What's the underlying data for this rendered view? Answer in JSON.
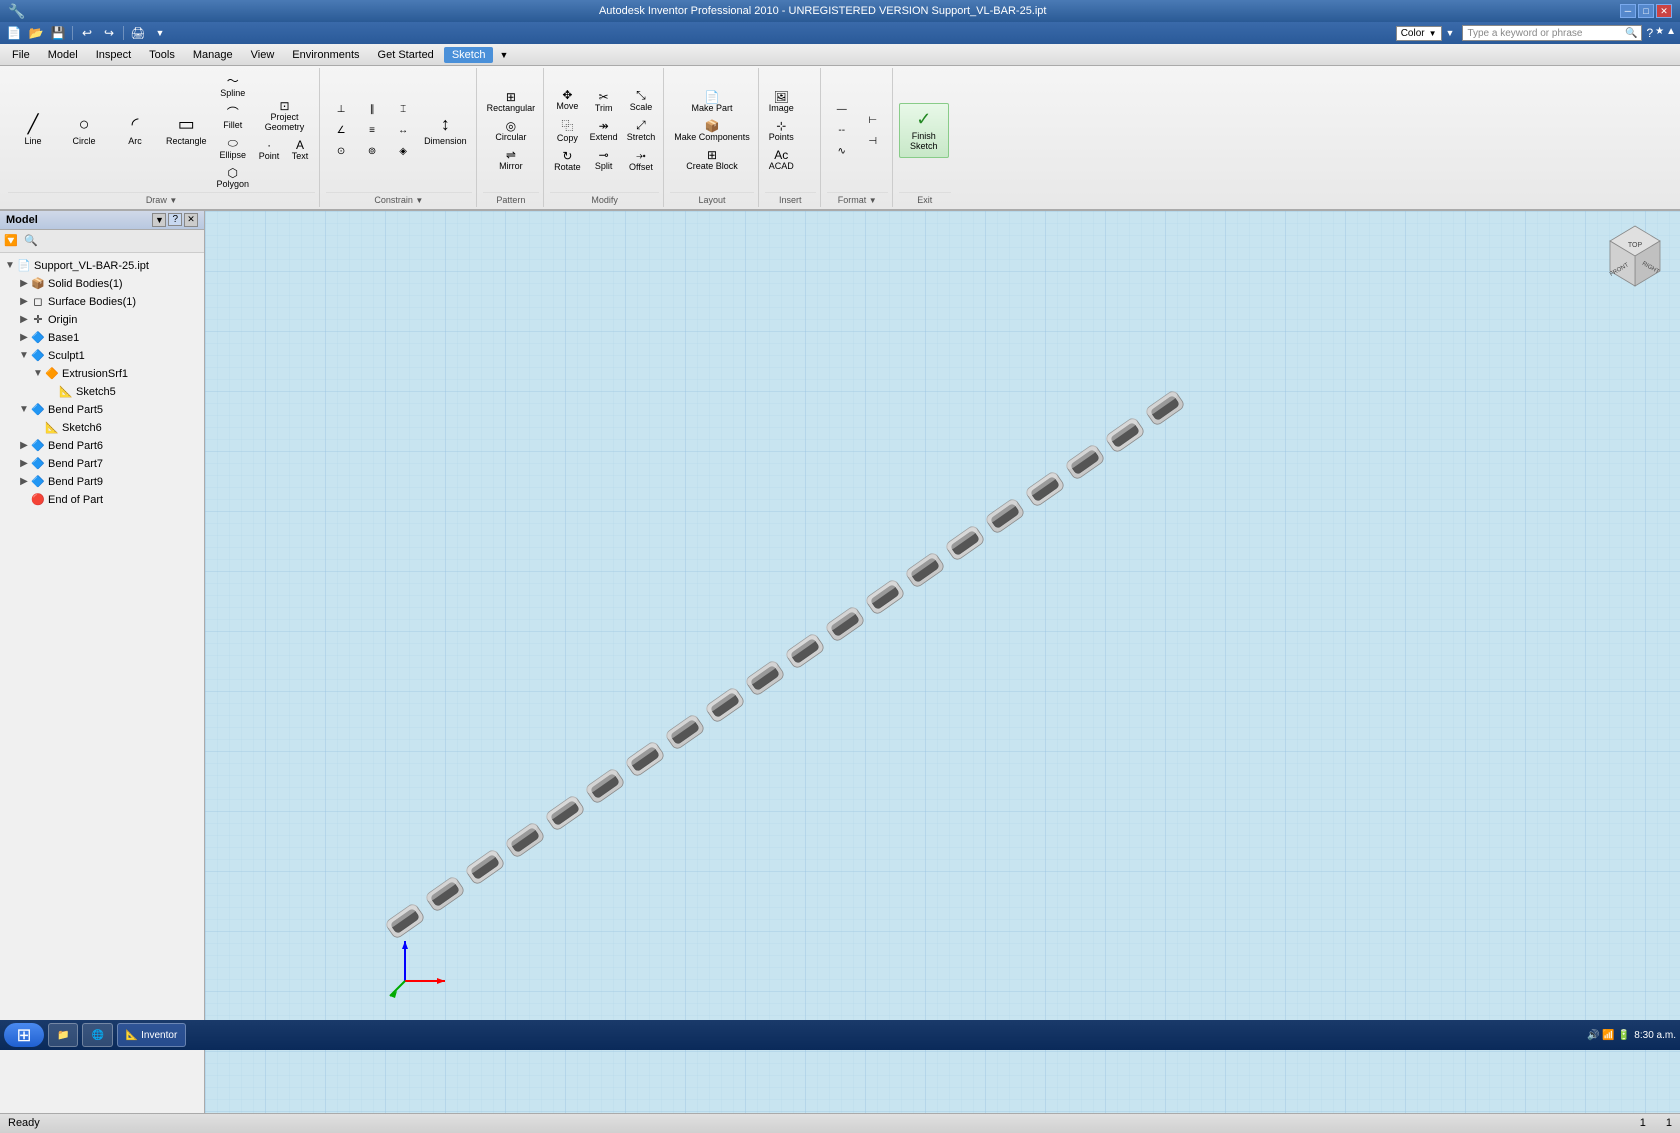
{
  "titlebar": {
    "title": "Autodesk Inventor Professional 2010 - UNREGISTERED VERSION    Support_VL-BAR-25.ipt",
    "minimize": "─",
    "maximize": "□",
    "close": "✕"
  },
  "quickaccess": {
    "buttons": [
      "↩",
      "↺",
      "↻",
      "💾",
      "📂",
      "🖨",
      "↩",
      "↩"
    ]
  },
  "menubar": {
    "items": [
      "File",
      "Model",
      "Inspect",
      "Tools",
      "Manage",
      "View",
      "Environments",
      "Get Started",
      "Sketch",
      "▼"
    ]
  },
  "ribbon": {
    "active_tab": "Sketch",
    "tabs": [
      "File",
      "Model",
      "Inspect",
      "Tools",
      "Manage",
      "View",
      "Environments",
      "Get Started",
      "Sketch"
    ],
    "groups": {
      "draw": {
        "label": "Draw",
        "tools": [
          "Line",
          "Circle",
          "Arc",
          "Rectangle",
          "Spline",
          "Fillet",
          "Ellipse",
          "Polygon",
          "Point",
          "Text",
          "Project Geometry"
        ]
      },
      "constrain": {
        "label": "Constrain"
      },
      "pattern": {
        "label": "Pattern",
        "tools": [
          "Rectangular",
          "Circular",
          "Mirror"
        ]
      },
      "modify": {
        "label": "Modify",
        "tools": [
          "Move",
          "Trim",
          "Scale",
          "Copy",
          "Extend",
          "Stretch",
          "Rotate",
          "Split",
          "Offset"
        ]
      },
      "layout": {
        "label": "Layout",
        "tools": [
          "Make Part",
          "Make Components",
          "Create Block"
        ]
      },
      "insert": {
        "label": "Insert",
        "tools": [
          "Image",
          "Points",
          "ACAD"
        ]
      },
      "format": {
        "label": "Format"
      },
      "exit": {
        "label": "Exit",
        "tools": [
          "Finish Sketch"
        ]
      }
    }
  },
  "panel": {
    "title": "Model",
    "dropdown": "▼",
    "close": "✕",
    "help": "?",
    "tree": [
      {
        "id": "root",
        "label": "Support_VL-BAR-25.ipt",
        "indent": 0,
        "expanded": true,
        "icon": "📄",
        "expand_icon": "▼"
      },
      {
        "id": "solid",
        "label": "Solid Bodies(1)",
        "indent": 1,
        "expanded": false,
        "icon": "📦",
        "expand_icon": "▶"
      },
      {
        "id": "surface",
        "label": "Surface Bodies(1)",
        "indent": 1,
        "expanded": false,
        "icon": "◻",
        "expand_icon": "▶"
      },
      {
        "id": "origin",
        "label": "Origin",
        "indent": 1,
        "expanded": false,
        "icon": "✛",
        "expand_icon": "▶"
      },
      {
        "id": "base1",
        "label": "Base1",
        "indent": 1,
        "expanded": false,
        "icon": "🔷",
        "expand_icon": "▶"
      },
      {
        "id": "sculpt1",
        "label": "Sculpt1",
        "indent": 1,
        "expanded": true,
        "icon": "🔷",
        "expand_icon": "▼"
      },
      {
        "id": "extrusion",
        "label": "ExtrusionSrf1",
        "indent": 2,
        "expanded": true,
        "icon": "🔶",
        "expand_icon": "▼"
      },
      {
        "id": "sketch5",
        "label": "Sketch5",
        "indent": 3,
        "expanded": false,
        "icon": "📐",
        "expand_icon": ""
      },
      {
        "id": "bendpart5",
        "label": "Bend Part5",
        "indent": 1,
        "expanded": true,
        "icon": "🔷",
        "expand_icon": "▼"
      },
      {
        "id": "sketch6",
        "label": "Sketch6",
        "indent": 2,
        "expanded": false,
        "icon": "📐",
        "expand_icon": ""
      },
      {
        "id": "bendpart6",
        "label": "Bend Part6",
        "indent": 1,
        "expanded": false,
        "icon": "🔷",
        "expand_icon": "▶"
      },
      {
        "id": "bendpart7",
        "label": "Bend Part7",
        "indent": 1,
        "expanded": false,
        "icon": "🔷",
        "expand_icon": "▶"
      },
      {
        "id": "bendpart9",
        "label": "Bend Part9",
        "indent": 1,
        "expanded": false,
        "icon": "🔷",
        "expand_icon": "▶"
      },
      {
        "id": "endofpart",
        "label": "End of Part",
        "indent": 1,
        "expanded": false,
        "icon": "🔴",
        "expand_icon": ""
      }
    ]
  },
  "viewport": {
    "background_color": "#c8e4f0",
    "grid_color": "#a8d4e8"
  },
  "viewcube": {
    "labels": [
      "FRONT",
      "RIGHT",
      "TOP"
    ]
  },
  "statusbar": {
    "left": "Ready",
    "right_col1": "1",
    "right_col2": "1"
  },
  "taskbar": {
    "time": "8:30 a.m.",
    "start_icon": "⊞",
    "apps": [
      "📁",
      "🌐",
      "📝",
      "🔧",
      "📊"
    ]
  },
  "colors": {
    "titlebar_bg": "#2a5a95",
    "ribbon_bg": "#e8e8e8",
    "grid_line": "#a0cce0",
    "viewport_bg": "#c8e4f0",
    "part_body": "#c0c0c0",
    "part_dark": "#a0a0a0",
    "accent": "#0078d7"
  }
}
